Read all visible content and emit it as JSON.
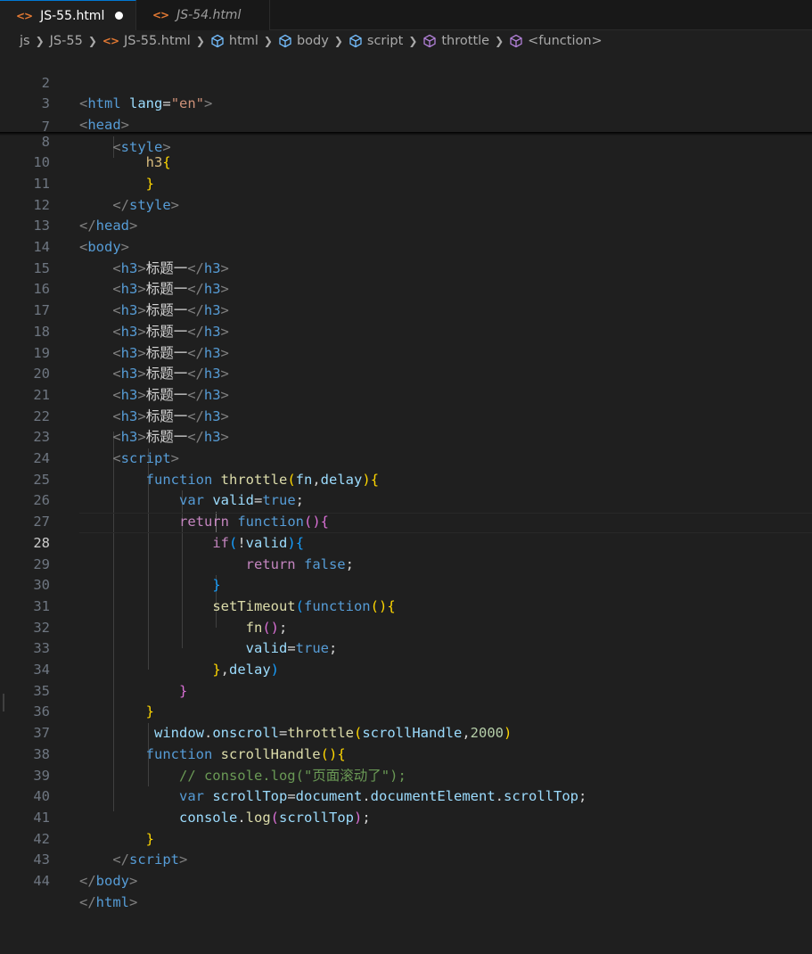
{
  "tabs": [
    {
      "label": "JS-55.html",
      "icon": "html-file-icon",
      "active": true,
      "modified": true
    },
    {
      "label": "JS-54.html",
      "icon": "html-file-icon",
      "active": false,
      "modified": false
    }
  ],
  "breadcrumbs": [
    "js",
    "JS-55",
    "JS-55.html",
    "html",
    "body",
    "script",
    "throttle",
    "<function>"
  ],
  "editor": {
    "current_line": 28,
    "line_numbers": [
      "2",
      "3",
      "7",
      "8",
      "10",
      "11",
      "12",
      "13",
      "14",
      "15",
      "16",
      "17",
      "18",
      "19",
      "20",
      "21",
      "22",
      "23",
      "24",
      "25",
      "26",
      "27",
      "28",
      "29",
      "30",
      "31",
      "32",
      "33",
      "34",
      "35",
      "36",
      "37",
      "38",
      "39",
      "40",
      "41",
      "42",
      "43",
      "44"
    ],
    "lines": {
      "l2": {
        "open": "<",
        "tag": "html",
        "attr": "lang",
        "eq": "=",
        "val": "\"en\"",
        "close": ">"
      },
      "l3": {
        "open": "<",
        "tag": "head",
        "close": ">"
      },
      "l7": {
        "open": "<",
        "tag": "style",
        "close": ">"
      },
      "l8": {
        "selector": "h3",
        "brace": "{"
      },
      "l10": {
        "brace": "}"
      },
      "l11": {
        "open": "</",
        "tag": "style",
        "close": ">"
      },
      "l12": {
        "open": "</",
        "tag": "head",
        "close": ">"
      },
      "l13": {
        "open": "<",
        "tag": "body",
        "close": ">"
      },
      "h3_row": {
        "open": "<",
        "tag": "h3",
        "close": ">",
        "text": "标题一",
        "end_open": "</",
        "end_close": ">"
      },
      "l23": {
        "open": "<",
        "tag": "script",
        "close": ">"
      },
      "l24": {
        "kw": "function",
        "name": "throttle",
        "lp": "(",
        "p1": "fn",
        "comma": ",",
        "p2": "delay",
        "rp": ")",
        "lb": "{"
      },
      "l25": {
        "kw": "var",
        "name": "valid",
        "eq": "=",
        "val": "true",
        "semi": ";"
      },
      "l26": {
        "kw": "return",
        "kw2": "function",
        "paren": "()",
        "lb": "{"
      },
      "l27": {
        "kw": "if",
        "lp": "(",
        "not": "!",
        "name": "valid",
        "rp": ")",
        "lb": "{"
      },
      "l28": {
        "kw": "return",
        "val": "false",
        "semi": ";"
      },
      "l29": {
        "rb": "}"
      },
      "l30": {
        "fn": "setTimeout",
        "lp": "(",
        "kw": "function",
        "paren": "()",
        "lb": "{"
      },
      "l31": {
        "fn": "fn",
        "paren": "()",
        "semi": ";"
      },
      "l32": {
        "name": "valid",
        "eq": "=",
        "val": "true",
        "semi": ";"
      },
      "l33": {
        "rb": "}",
        "comma": ",",
        "name": "delay",
        "rp": ")"
      },
      "l34": {
        "rb": "}"
      },
      "l35": {
        "rb": "}"
      },
      "l36": {
        "obj": "window",
        "dot": ".",
        "prop": "onscroll",
        "eq": "=",
        "fn": "throttle",
        "lp": "(",
        "arg": "scrollHandle",
        "comma": ",",
        "num": "2000",
        "rp": ")"
      },
      "l37": {
        "kw": "function",
        "name": "scrollHandle",
        "paren": "()",
        "lb": "{"
      },
      "l38": {
        "comment": "// console.log(\"页面滚动了\");"
      },
      "l39": {
        "kw": "var",
        "name": "scrollTop",
        "eq": "=",
        "obj": "document",
        "dot1": ".",
        "prop1": "documentElement",
        "dot2": ".",
        "prop2": "scrollTop",
        "semi": ";"
      },
      "l40": {
        "obj": "console",
        "dot": ".",
        "fn": "log",
        "lp": "(",
        "arg": "scrollTop",
        "rp": ")",
        "semi": ";"
      },
      "l41": {
        "rb": "}"
      },
      "l42": {
        "open": "</",
        "tag": "script",
        "close": ">"
      },
      "l43": {
        "open": "</",
        "tag": "body",
        "close": ">"
      },
      "l44": {
        "open": "</",
        "tag": "html",
        "close": ">"
      }
    }
  },
  "colors": {
    "background": "#1f1f1f",
    "tab_bar": "#181818",
    "accent": "#0078d4",
    "html_file_icon": "#e37933",
    "symbol_icon": "#75beff",
    "function_icon": "#b180d7"
  }
}
